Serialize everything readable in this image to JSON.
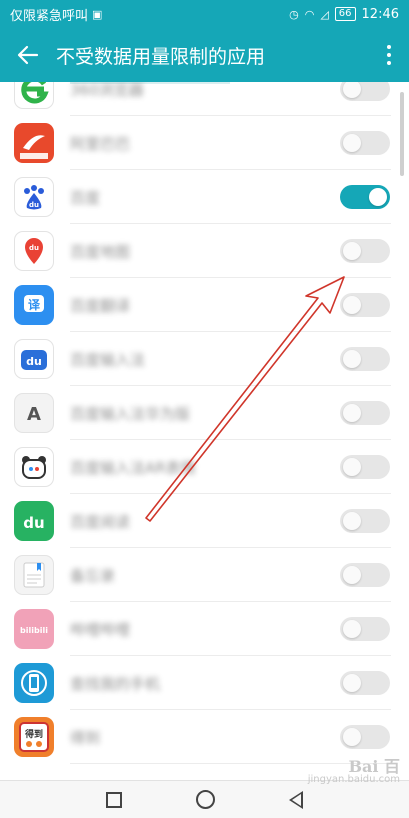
{
  "status_bar": {
    "carrier_text": "仅限紧急呼叫",
    "battery": "66",
    "time": "12:46"
  },
  "header": {
    "title": "不受数据用量限制的应用"
  },
  "apps": [
    {
      "label": "360浏览器",
      "icon": "360-browser-icon",
      "icon_color": "#ffffff",
      "enabled": false
    },
    {
      "label": "阿里巴巴",
      "icon": "alibaba-icon",
      "icon_color": "#e8492c",
      "enabled": false
    },
    {
      "label": "百度",
      "icon": "baidu-icon",
      "icon_color": "#ffffff",
      "enabled": true
    },
    {
      "label": "百度地图",
      "icon": "baidu-map-icon",
      "icon_color": "#ffffff",
      "enabled": false
    },
    {
      "label": "百度翻译",
      "icon": "baidu-translate-icon",
      "icon_color": "#2d8ff0",
      "enabled": false
    },
    {
      "label": "百度输入法",
      "icon": "baidu-input-icon",
      "icon_color": "#ffffff",
      "enabled": false
    },
    {
      "label": "百度输入法华为版",
      "icon": "input-a-icon",
      "icon_color": "#f3f3f3",
      "enabled": false
    },
    {
      "label": "百度输入法AR表情",
      "icon": "bear-icon",
      "icon_color": "#ffffff",
      "enabled": false
    },
    {
      "label": "百度阅读",
      "icon": "baidu-read-icon",
      "icon_color": "#27b262",
      "enabled": false
    },
    {
      "label": "备忘录",
      "icon": "memo-icon",
      "icon_color": "#f4f4f4",
      "enabled": false
    },
    {
      "label": "哔哩哔哩",
      "icon": "bilibili-icon",
      "icon_color": "#f1a2b8",
      "enabled": false
    },
    {
      "label": "查找我的手机",
      "icon": "find-phone-icon",
      "icon_color": "#1e9ad6",
      "enabled": false
    },
    {
      "label": "得到",
      "icon": "dedao-icon",
      "icon_color": "#f07f2b",
      "enabled": false
    }
  ],
  "watermark": {
    "logo": "Bai 百",
    "site": "jingyan.baidu.com"
  },
  "colors": {
    "accent": "#15a7b7",
    "arrow": "#d0362b"
  }
}
